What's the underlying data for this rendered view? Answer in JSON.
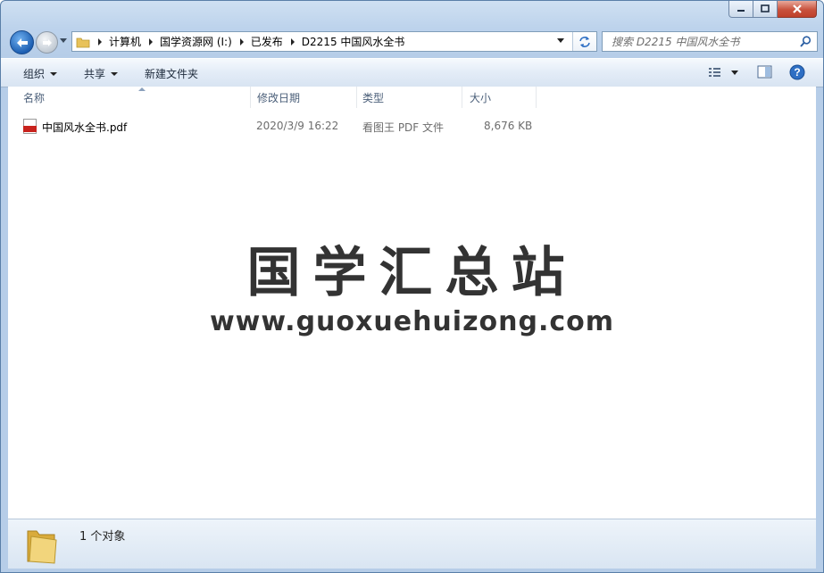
{
  "window": {
    "controls": {
      "minimize": "minimize",
      "maximize": "maximize",
      "close": "close"
    }
  },
  "nav": {
    "breadcrumbs": [
      "计算机",
      "国学资源网 (I:)",
      "已发布",
      "D2215 中国风水全书"
    ],
    "search_placeholder": "搜索 D2215 中国风水全书"
  },
  "toolbar": {
    "organize_label": "组织",
    "share_label": "共享",
    "new_folder_label": "新建文件夹"
  },
  "columns": {
    "name": "名称",
    "modified": "修改日期",
    "type": "类型",
    "size": "大小"
  },
  "files": [
    {
      "name": "中国风水全书.pdf",
      "modified": "2020/3/9 16:22",
      "type": "看图王 PDF 文件",
      "size": "8,676 KB",
      "icon": "pdf-icon"
    }
  ],
  "watermark": {
    "title": "国学汇总站",
    "url": "www.guoxuehuizong.com"
  },
  "details": {
    "count_text": "1 个对象"
  },
  "colors": {
    "accent": "#1d5fb2",
    "close": "#c8523d",
    "pdf_red": "#c8221d",
    "folder": "#e8c25a"
  }
}
